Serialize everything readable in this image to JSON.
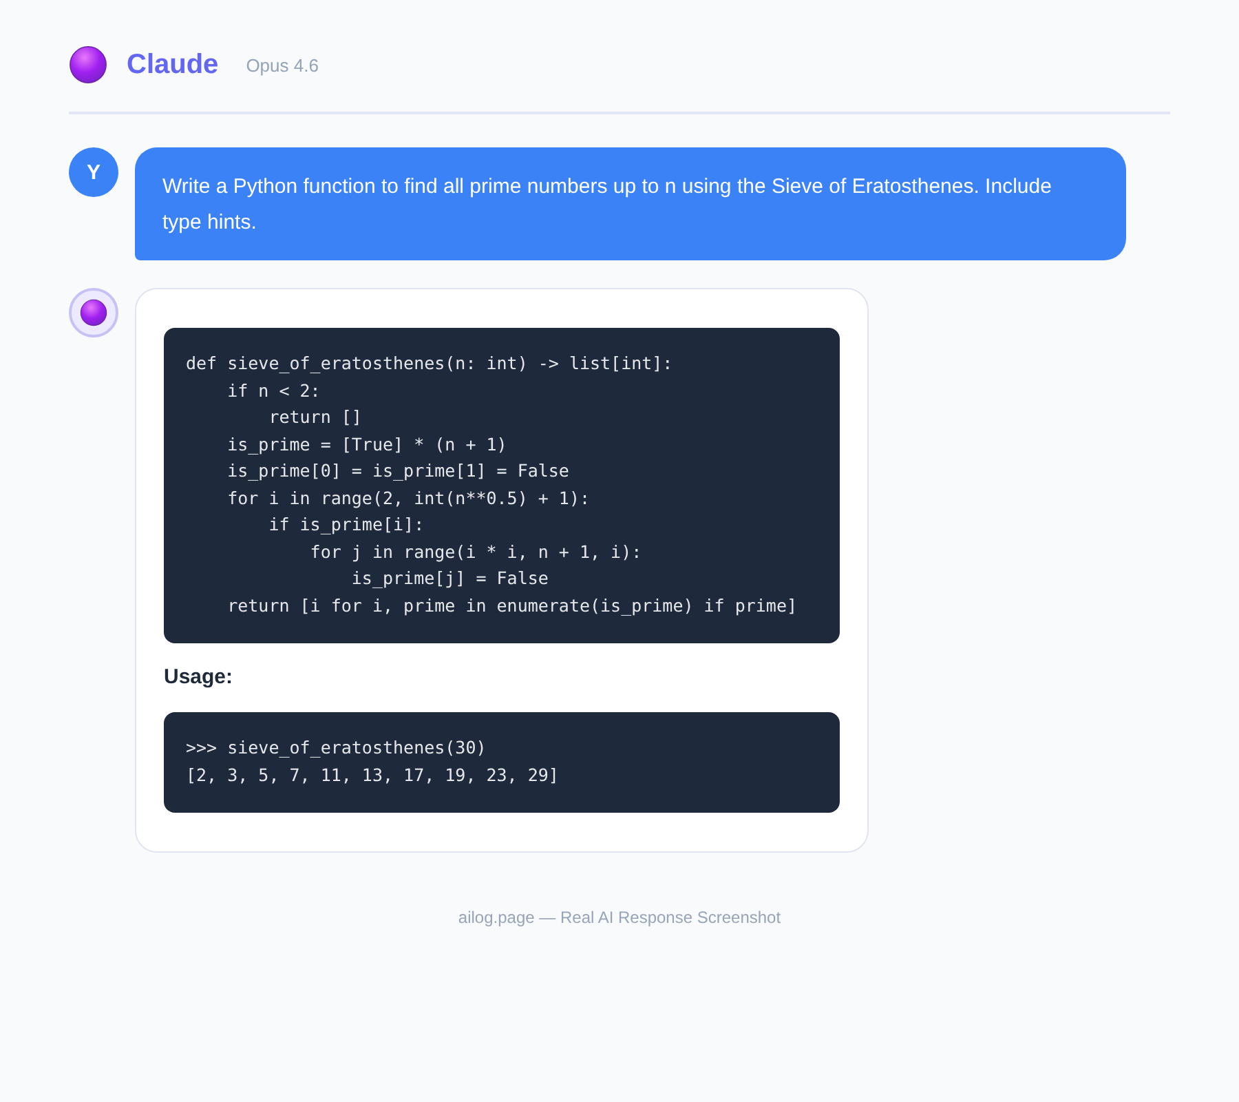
{
  "header": {
    "title": "Claude",
    "model": "Opus 4.6"
  },
  "messages": [
    {
      "kind": "user",
      "avatar": "Y",
      "text": "Write a Python function to find all prime numbers up to n using the Sieve of Eratosthenes. Include type hints."
    },
    {
      "kind": "assistant",
      "blocks": [
        {
          "kind": "code",
          "lines": [
            "def sieve_of_eratosthenes(n: int) -> list[int]:",
            "    if n < 2:",
            "        return []",
            "    is_prime = [True] * (n + 1)",
            "    is_prime[0] = is_prime[1] = False",
            "    for i in range(2, int(n**0.5) + 1):",
            "        if is_prime[i]:",
            "            for j in range(i * i, n + 1, i):",
            "                is_prime[j] = False",
            "    return [i for i, prime in enumerate(is_prime) if prime]"
          ]
        },
        {
          "kind": "label",
          "text": "Usage:"
        },
        {
          "kind": "code",
          "lines": [
            ">>> sieve_of_eratosthenes(30)",
            "[2, 3, 5, 7, 11, 13, 17, 19, 23, 29]"
          ]
        }
      ]
    }
  ],
  "footer": "ailog.page — Real AI Response Screenshot"
}
